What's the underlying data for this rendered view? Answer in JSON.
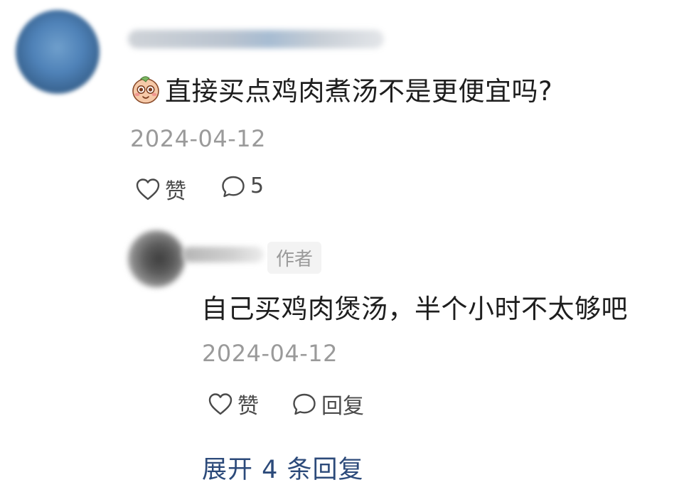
{
  "main_comment": {
    "text": "直接买点鸡肉煮汤不是更便宜吗?",
    "date": "2024-04-12",
    "like_label": "赞",
    "reply_count": "5"
  },
  "reply": {
    "author_badge": "作者",
    "text": "自己买鸡肉煲汤，半个小时不太够吧",
    "date": "2024-04-12",
    "like_label": "赞",
    "reply_label": "回复"
  },
  "expand_replies": "展开 4 条回复"
}
